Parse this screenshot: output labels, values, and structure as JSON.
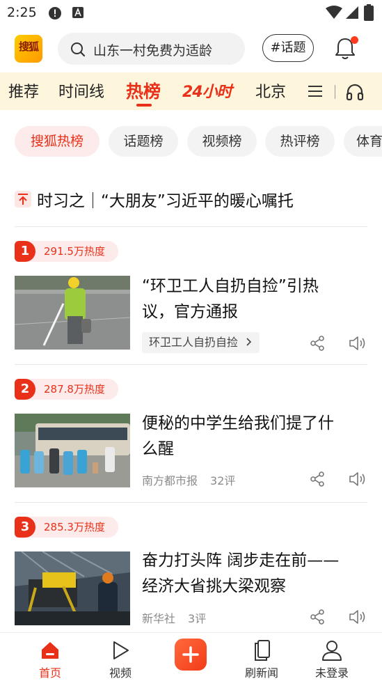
{
  "status_bar": {
    "time": "2:25",
    "icons": [
      "alert-icon",
      "font-icon",
      "wifi-icon",
      "signal-icon",
      "battery-icon"
    ]
  },
  "header": {
    "logo_text": "搜狐",
    "search_placeholder": "山东一村免费为适龄",
    "topic_button": "#话题",
    "notification_icon": "bell-icon"
  },
  "channels": {
    "items": [
      "推荐",
      "时间线",
      "热榜",
      "24小时",
      "北京"
    ],
    "active": "热榜",
    "menu_icon": "menu-icon",
    "audio_icon": "headphones-icon"
  },
  "filter_tabs": {
    "items": [
      "搜狐热榜",
      "话题榜",
      "视频榜",
      "热评榜",
      "体育"
    ],
    "active": "搜狐热榜"
  },
  "pinned": {
    "text": "时习之｜“大朋友”习近平的暖心嘱托"
  },
  "ranking": [
    {
      "rank": "1",
      "heat": "291.5万热度",
      "title_line1": "“环卫工人自扔自捡”引热",
      "title_line2": "议，官方通报",
      "tag": "环卫工人自扔自捡",
      "source": "",
      "comments": ""
    },
    {
      "rank": "2",
      "heat": "287.8万热度",
      "title_line1": "便秘的中学生给我们提了什",
      "title_line2": "么醒",
      "source": "南方都市报",
      "comments": "32评"
    },
    {
      "rank": "3",
      "heat": "285.3万热度",
      "title_line1": "奋力打头阵 阔步走在前——",
      "title_line2": "经济大省挑大梁观察",
      "source": "新华社",
      "comments": "3评"
    }
  ],
  "bottom_nav": {
    "items": [
      "首页",
      "视频",
      "刷新闻",
      "未登录"
    ],
    "active": "首页",
    "accent": "#e9311a"
  }
}
